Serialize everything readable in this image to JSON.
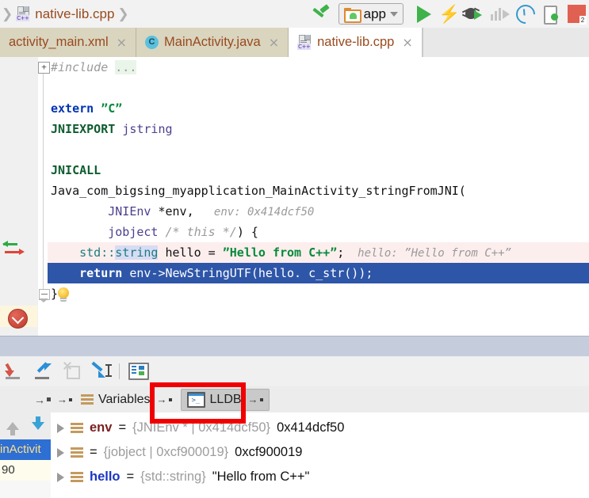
{
  "toolbar": {
    "breadcrumb": [
      {
        "name": "native-lib.cpp",
        "icon": "cpp-file-icon",
        "tag": "C++"
      }
    ],
    "build_icon": "hammer-build-icon",
    "run_config": {
      "label": "app",
      "icon": "android-module-icon",
      "caret": "chevron-down-icon"
    },
    "actions": [
      {
        "name": "run-button",
        "icon": "play-icon"
      },
      {
        "name": "apply-changes-button",
        "icon": "lightning-bolt-icon"
      },
      {
        "name": "debug-button",
        "icon": "bug-debug-icon"
      },
      {
        "name": "run-with-coverage-button",
        "icon": "coverage-bars-icon"
      },
      {
        "name": "profiler-button",
        "icon": "gauge-profiler-icon"
      },
      {
        "name": "avd-manager-button",
        "icon": "device-manager-icon"
      },
      {
        "name": "problems-button",
        "icon": "red-square-icon",
        "badge": "2"
      }
    ]
  },
  "tabs": [
    {
      "label": "activity_main.xml",
      "icon": "xml-file-icon",
      "active": false,
      "close": "×"
    },
    {
      "label": "MainActivity.java",
      "icon": "java-class-icon",
      "icon_letter": "C",
      "active": false,
      "close": "×"
    },
    {
      "label": "native-lib.cpp",
      "icon": "cpp-file-icon",
      "icon_tag": "C++",
      "active": true,
      "close": "×"
    }
  ],
  "editor": {
    "fold_plus": "+",
    "lines": [
      {
        "id": "include",
        "segments": [
          {
            "t": "#include ",
            "c": "cmt"
          },
          {
            "t": "...",
            "c": "folded"
          }
        ]
      },
      {
        "id": "blank1",
        "segments": []
      },
      {
        "id": "extern",
        "segments": [
          {
            "t": "extern ",
            "c": "kw"
          },
          {
            "t": "”C”",
            "c": "str"
          }
        ]
      },
      {
        "id": "jniexport",
        "segments": [
          {
            "t": "JNIEXPORT ",
            "c": "kw2"
          },
          {
            "t": "jstring",
            "c": "cls"
          }
        ]
      },
      {
        "id": "blank2",
        "segments": []
      },
      {
        "id": "jnicall",
        "segments": [
          {
            "t": "JNICALL",
            "c": "kw2"
          }
        ]
      },
      {
        "id": "signature",
        "segments": [
          {
            "t": "Java_com_bigsing_myapplication_MainActivity_stringFromJNI(",
            "c": "fn"
          }
        ]
      },
      {
        "id": "param-env",
        "segments": [
          {
            "t": "        ",
            "c": "plain"
          },
          {
            "t": "JNIEnv",
            "c": "cls"
          },
          {
            "t": " *env,",
            "c": "fn"
          },
          {
            "t": "   env: 0x414dcf50",
            "c": "hint"
          }
        ]
      },
      {
        "id": "param-this",
        "segments": [
          {
            "t": "        ",
            "c": "plain"
          },
          {
            "t": "jobject",
            "c": "cls"
          },
          {
            "t": " ",
            "c": "plain"
          },
          {
            "t": "/* this */",
            "c": "cmt"
          },
          {
            "t": ") {",
            "c": "fn"
          }
        ]
      },
      {
        "id": "hello-decl",
        "exec": true,
        "segments": [
          {
            "t": "    ",
            "c": "plain"
          },
          {
            "t": "std::",
            "c": "typ"
          },
          {
            "t": "string",
            "c": "typ sel-word"
          },
          {
            "t": " hello = ",
            "c": "fn"
          },
          {
            "t": "”Hello from C++”",
            "c": "str"
          },
          {
            "t": ";",
            "c": "fn"
          },
          {
            "t": "  hello: ”Hello from C++”",
            "c": "hint"
          }
        ]
      },
      {
        "id": "return",
        "cursor": true,
        "segments": [
          {
            "t": "    ",
            "c": "plain"
          },
          {
            "t": "return",
            "c": "kw"
          },
          {
            "t": " env->NewStringUTF(hello. c_str());",
            "c": "fn"
          }
        ]
      },
      {
        "id": "closebrace",
        "segments": [
          {
            "t": "}",
            "c": "fn"
          }
        ]
      }
    ],
    "gutter": {
      "breakpoint": "breakpoint-icon",
      "intention_bulb": "lightbulb-intention-icon",
      "change_arrows": "green-red-arrows-icon"
    }
  },
  "debug_toolbar": {
    "buttons": [
      {
        "name": "step-over-button",
        "icon": "step-over-icon",
        "enabled": true
      },
      {
        "name": "step-into-button",
        "icon": "step-into-icon",
        "enabled": true
      },
      {
        "name": "force-step-into-button",
        "icon": "force-step-into-icon",
        "enabled": false
      },
      {
        "name": "run-to-cursor-button",
        "icon": "run-to-cursor-icon",
        "enabled": true
      },
      {
        "name": "evaluate-expression-button",
        "icon": "evaluate-expression-icon",
        "enabled": true
      }
    ]
  },
  "debug_panel": {
    "frames": {
      "pin_icon": "pin-tab-icon",
      "up_icon": "arrow-up-icon",
      "down_icon": "arrow-down-icon",
      "selected_frame": "inActivit",
      "next_frame": "90"
    },
    "tabs": [
      {
        "label": "Variables",
        "icon": "frames-stack-icon",
        "selected": false,
        "pin": "→"
      },
      {
        "label": "LLDB",
        "icon": "lldb-console-icon",
        "selected": true,
        "pin": "→"
      }
    ],
    "variables": [
      {
        "expander": "expand-triangle",
        "icon": "variable-icon",
        "name": "env",
        "name_class": "env",
        "eq": " = ",
        "type": "{JNIEnv * | 0x414dcf50}",
        "value": "0x414dcf50"
      },
      {
        "expander": "expand-triangle",
        "icon": "variable-icon",
        "name": "",
        "name_class": "plain",
        "eq": " = ",
        "type": "{jobject | 0xcf900019}",
        "value": "0xcf900019"
      },
      {
        "expander": "expand-triangle",
        "icon": "variable-icon",
        "name": "hello",
        "name_class": "hello",
        "eq": " = ",
        "type": "{std::string}",
        "value": "\"Hello from C++\""
      }
    ]
  },
  "annotation": {
    "name": "red-highlight-rectangle",
    "color": "#f00000",
    "target": "LLDB"
  },
  "colors": {
    "accent_blue": "#2e56a8",
    "exec_line": "#fdeeee",
    "breakpoint_red": "#c9473a",
    "tab_inactive": "#d9d5bf",
    "splitter": "#c5cddd"
  }
}
